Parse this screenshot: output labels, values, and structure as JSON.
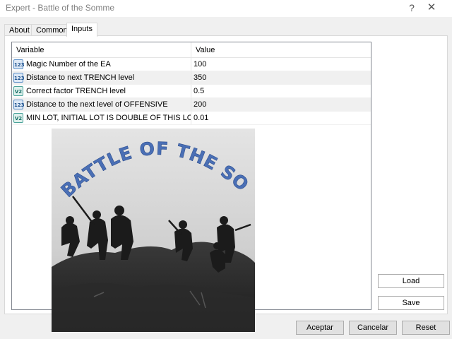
{
  "window": {
    "title": "Expert - Battle of the Somme",
    "help_glyph": "?",
    "close_glyph": "✕"
  },
  "tabs": [
    {
      "label": "About",
      "active": false
    },
    {
      "label": "Common",
      "active": false
    },
    {
      "label": "Inputs",
      "active": true
    }
  ],
  "table": {
    "columns": {
      "variable": "Variable",
      "value": "Value"
    },
    "rows": [
      {
        "icon": "int-type-icon",
        "type_text": "123",
        "variable": "Magic Number of the EA",
        "value": "100"
      },
      {
        "icon": "int-type-icon",
        "type_text": "123",
        "variable": "Distance to next TRENCH level",
        "value": "350"
      },
      {
        "icon": "double-type-icon",
        "type_text": "V2",
        "variable": "Correct factor TRENCH level",
        "value": "0.5"
      },
      {
        "icon": "int-type-icon",
        "type_text": "123",
        "variable": "Distance to the next level of OFFENSIVE",
        "value": "200"
      },
      {
        "icon": "double-type-icon",
        "type_text": "V2",
        "variable": "MIN LOT, INITIAL  LOT IS DOUBLE OF THIS LOT",
        "value": "0.01"
      }
    ]
  },
  "picture": {
    "caption": "BATTLE OF THE SOMME"
  },
  "buttons": {
    "load": "Load",
    "save": "Save",
    "accept": "Aceptar",
    "cancel": "Cancelar",
    "reset": "Reset"
  }
}
